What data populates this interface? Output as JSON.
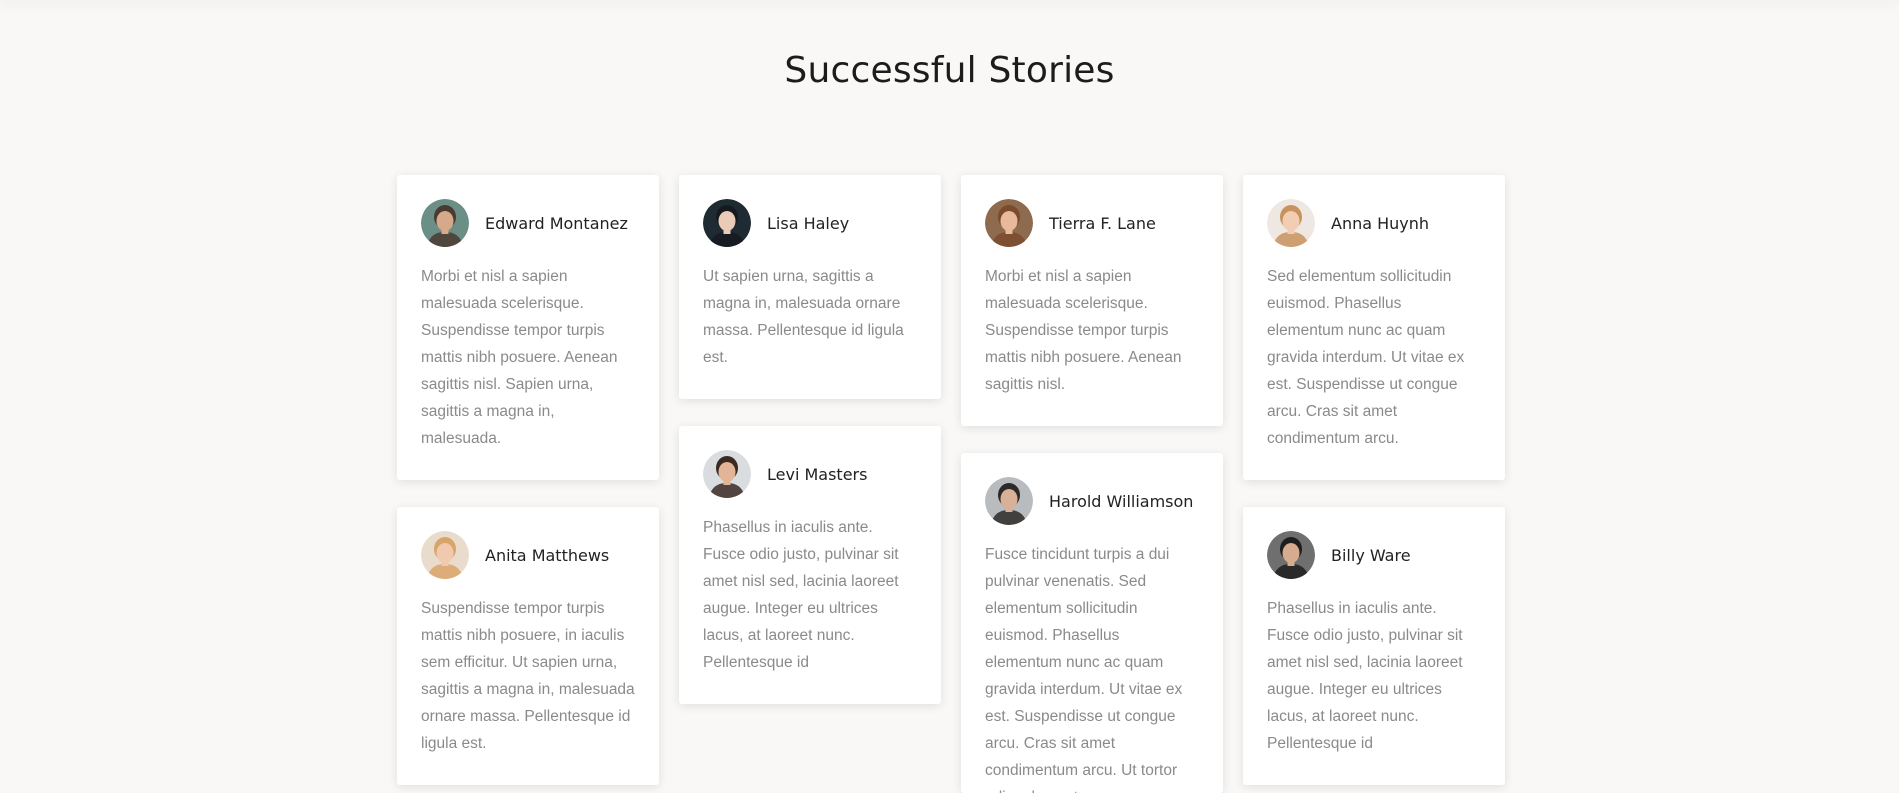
{
  "section": {
    "title": "Successful Stories"
  },
  "columns": [
    [
      {
        "name": "Edward Montanez",
        "text": "Morbi et nisl a sapien malesuada scelerisque. Suspendisse tempor turpis mattis nibh posuere. Aenean sagittis nisl. Sapien urna, sagittis a magna in, malesuada.",
        "avatar_bg": "#6b8f86",
        "skin": "#d6a98a",
        "hair": "#4a3a30"
      },
      {
        "name": "Anita Matthews",
        "text": "Suspendisse tempor turpis mattis nibh posuere, in iaculis sem efficitur. Ut sapien urna, sagittis a magna in, malesuada ornare massa. Pellentesque id ligula est.",
        "avatar_bg": "#e9dccd",
        "skin": "#f0c9ae",
        "hair": "#d9a46a"
      }
    ],
    [
      {
        "name": "Lisa Haley",
        "text": "Ut sapien urna, sagittis a magna in, malesuada ornare massa. Pellentesque id ligula est.",
        "avatar_bg": "#1f2b33",
        "skin": "#e9cbb8",
        "hair": "#151a1e"
      },
      {
        "name": "Levi Masters",
        "text": "Phasellus in iaculis ante. Fusce odio justo, pulvinar sit amet nisl sed, lacinia laoreet augue. Integer eu ultrices lacus, at laoreet nunc. Pellentesque id",
        "avatar_bg": "#d9dde0",
        "skin": "#e2b596",
        "hair": "#3a2a22"
      }
    ],
    [
      {
        "name": "Tierra F. Lane",
        "text": "Morbi et nisl a sapien malesuada scelerisque. Suspendisse tempor turpis mattis nibh posuere. Aenean sagittis nisl.",
        "avatar_bg": "#8e6a4f",
        "skin": "#e8b99b",
        "hair": "#7a4b2c"
      },
      {
        "name": "Harold Williamson",
        "text": "Fusce tincidunt turpis a dui pulvinar venenatis. Sed elementum sollicitudin euismod. Phasellus elementum nunc ac quam gravida interdum. Ut vitae ex est. Suspendisse ut congue arcu. Cras sit amet condimentum arcu. Ut tortor odio, elementum",
        "avatar_bg": "#b8bcbf",
        "skin": "#d9b198",
        "hair": "#2c2a28"
      }
    ],
    [
      {
        "name": "Anna Huynh",
        "text": "Sed elementum sollicitudin euismod. Phasellus elementum nunc ac quam gravida interdum. Ut vitae ex est. Suspendisse ut congue arcu. Cras sit amet condimentum arcu.",
        "avatar_bg": "#efe7e2",
        "skin": "#f1cdb3",
        "hair": "#c8925c"
      },
      {
        "name": "Billy Ware",
        "text": "Phasellus in iaculis ante. Fusce odio justo, pulvinar sit amet nisl sed, lacinia laoreet augue. Integer eu ultrices lacus, at laoreet nunc. Pellentesque id",
        "avatar_bg": "#6f6f6f",
        "skin": "#d7ab8e",
        "hair": "#1e1e1e"
      }
    ]
  ]
}
